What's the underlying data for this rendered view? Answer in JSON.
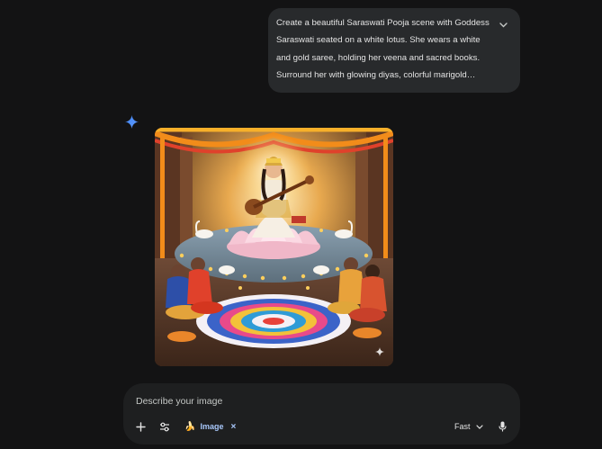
{
  "prompt": {
    "text": "Create a beautiful Saraswati Pooja scene with Goddess Saraswati seated on a white lotus. She wears a white and gold saree, holding her veena and sacred books. Surround her with glowing diyas, colorful marigold garlands, and children offering flowers. Include a soft,..."
  },
  "response": {
    "icon": "gemini-sparkle-icon",
    "image_subject": "saraswati-pooja-scene"
  },
  "composer": {
    "placeholder": "Describe your image",
    "value": "",
    "tool_chip": {
      "emoji": "🍌",
      "label": "Image",
      "remove": "×"
    },
    "mode_label": "Fast"
  },
  "colors": {
    "background": "#131314",
    "bubble": "#282a2c",
    "composer": "#1e1f20",
    "accent": "#a8c7fa",
    "gemini_blue": "#4285f4"
  }
}
